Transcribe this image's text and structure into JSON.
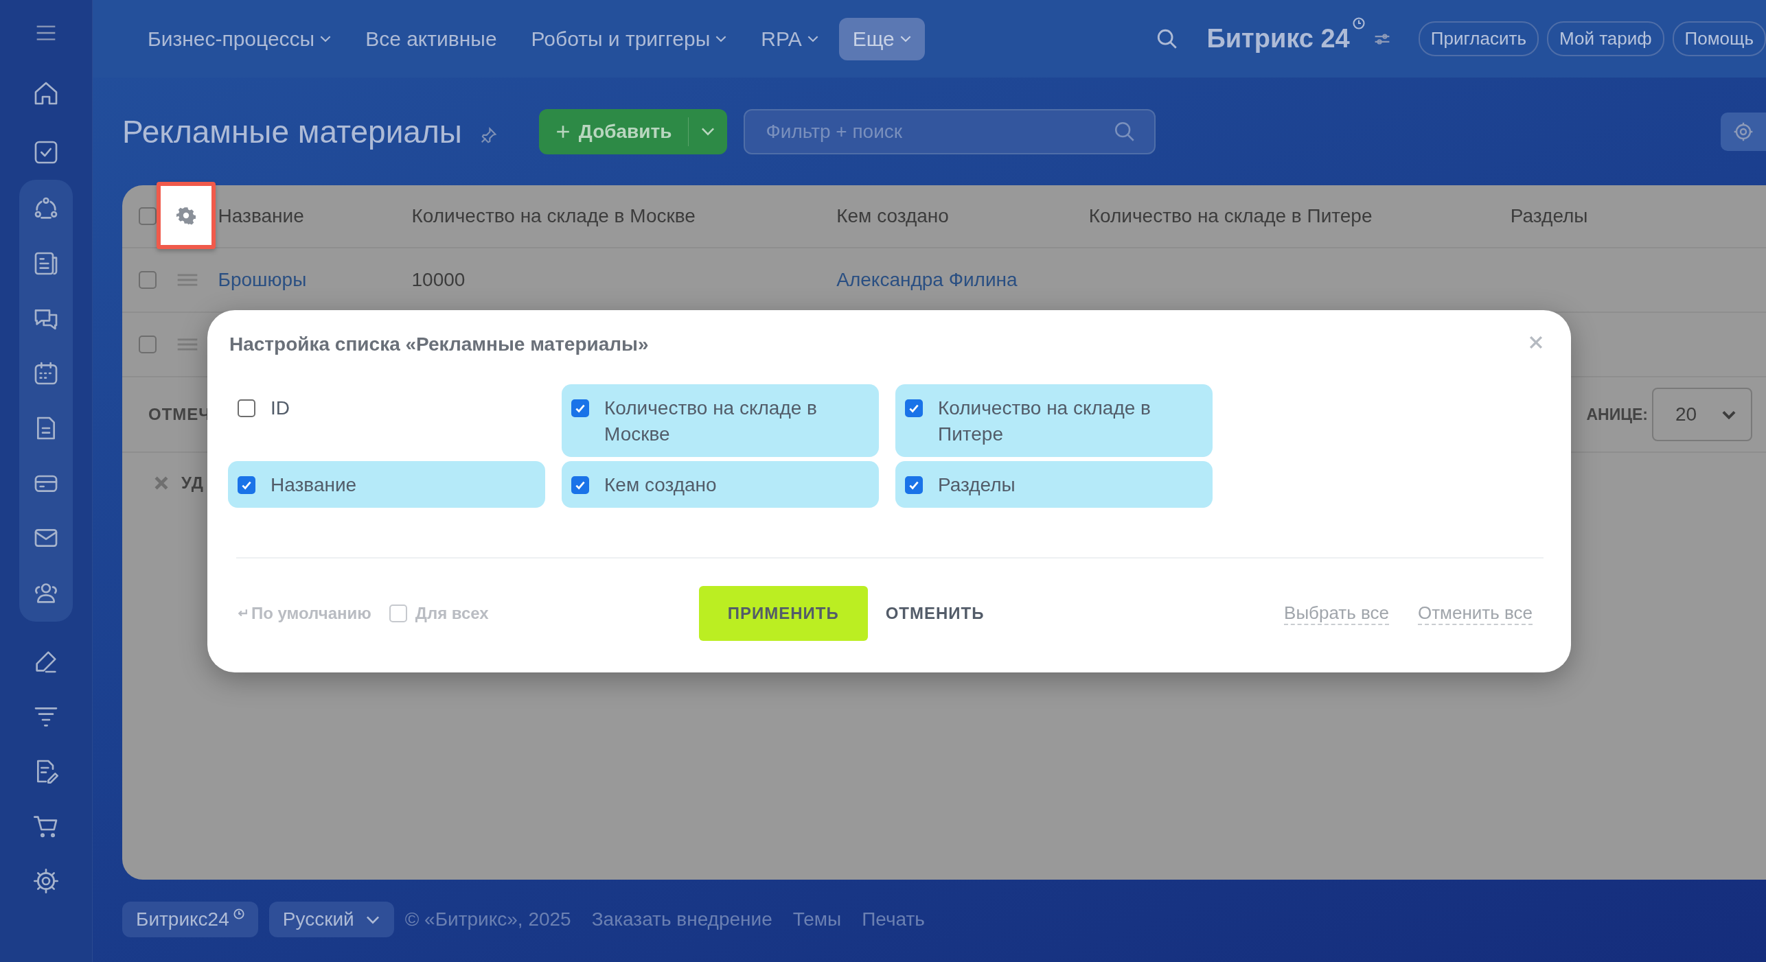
{
  "top_nav": [
    {
      "label": "Бизнес-процессы",
      "dropdown": true,
      "selected": false
    },
    {
      "label": "Все активные",
      "dropdown": false,
      "selected": false
    },
    {
      "label": "Роботы и триггеры",
      "dropdown": true,
      "selected": false
    },
    {
      "label": "RPA",
      "dropdown": true,
      "selected": false
    },
    {
      "label": "Еще",
      "dropdown": true,
      "selected": true
    }
  ],
  "brand": {
    "name": "Битрикс 24"
  },
  "header_buttons": [
    "Пригласить",
    "Мой тариф",
    "Помощь"
  ],
  "page": {
    "title": "Рекламные материалы",
    "add_button": "Добавить",
    "search": {
      "placeholder": "Фильтр + поиск"
    }
  },
  "table": {
    "columns": [
      "Название",
      "Количество на складе в Москве",
      "Кем создано",
      "Количество на складе в Питере",
      "Разделы"
    ],
    "rows": [
      {
        "checked": false,
        "cells": [
          "Брошюры",
          "10000",
          "Александра Филина",
          "",
          ""
        ]
      },
      {
        "checked": false,
        "cells": [
          "",
          "",
          "",
          "",
          ""
        ]
      }
    ],
    "select_all_checked": false,
    "selected_label": "ОТМЕЧ",
    "page_size_label": "АНИЦЕ:",
    "page_size": "20",
    "delete_label": "УД"
  },
  "modal": {
    "title": "Настройка списка «Рекламные материалы»",
    "options": [
      {
        "label": "ID",
        "checked": false
      },
      {
        "label": "Название",
        "checked": true
      },
      {
        "label": "Количество на складе в Москве",
        "checked": true
      },
      {
        "label": "Кем создано",
        "checked": true
      },
      {
        "label": "Количество на складе в Питере",
        "checked": true
      },
      {
        "label": "Разделы",
        "checked": true
      }
    ],
    "reset_label": "По умолчанию",
    "for_all": {
      "label": "Для всех",
      "checked": false
    },
    "apply": "ПРИМЕНИТЬ",
    "cancel": "ОТМЕНИТЬ",
    "select_all": "Выбрать все",
    "deselect_all": "Отменить все"
  },
  "footer": {
    "brand": "Битрикс24",
    "language": "Русский",
    "copyright": "© «Битрикс», 2025",
    "links": [
      "Заказать внедрение",
      "Темы",
      "Печать"
    ]
  }
}
